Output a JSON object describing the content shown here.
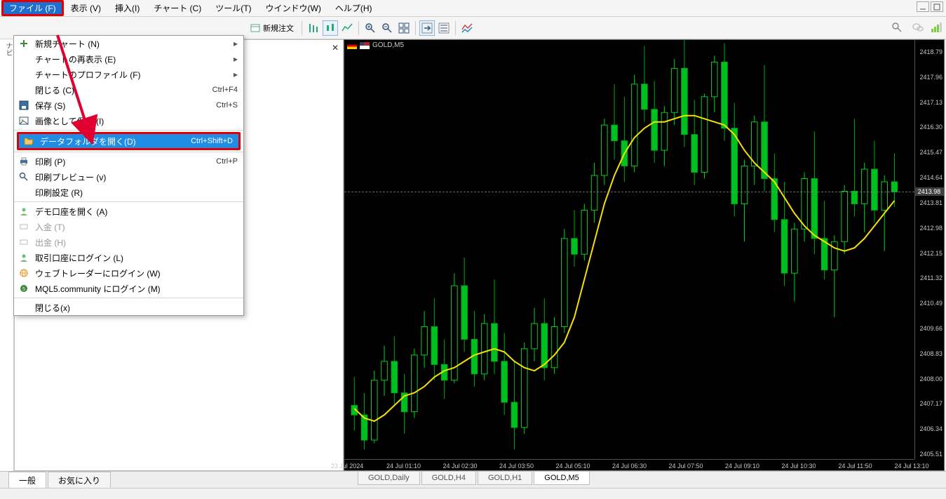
{
  "menubar": {
    "file": "ファイル (F)",
    "view": "表示 (V)",
    "insert": "挿入(I)",
    "chart": "チャート (C)",
    "tool": "ツール(T)",
    "window": "ウインドウ(W)",
    "help": "ヘルプ(H)"
  },
  "toolbar": {
    "new_order_label": "新規注文"
  },
  "file_menu": {
    "new_chart": "新規チャート (N)",
    "redisplay": "チャートの再表示 (E)",
    "profile": "チャートのプロファイル (F)",
    "close": "閉じる (C)",
    "close_sc": "Ctrl+F4",
    "save": "保存 (S)",
    "save_sc": "Ctrl+S",
    "save_image": "画像として保存 (I)",
    "open_data": "データフォルダを開く(D)",
    "open_data_sc": "Ctrl+Shift+D",
    "print": "印刷 (P)",
    "print_sc": "Ctrl+P",
    "preview": "印刷プレビュー (v)",
    "page_setup": "印刷設定 (R)",
    "open_demo": "デモ口座を開く (A)",
    "deposit": "入金 (T)",
    "withdraw": "出金 (H)",
    "login_trade": "取引口座にログイン (L)",
    "login_web": "ウェブトレーダーにログイン (W)",
    "login_mql5": "MQL5.community にログイン (M)",
    "exit": "閉じる(x)"
  },
  "nav_label": "ナビ",
  "chart": {
    "symbol": "GOLD,M5",
    "current_price": "2413.98",
    "y_ticks": [
      "2418.79",
      "2417.96",
      "2417.13",
      "2416.30",
      "2415.47",
      "2414.64",
      "2413.81",
      "2412.98",
      "2412.15",
      "2411.32",
      "2410.49",
      "2409.66",
      "2408.83",
      "2408.00",
      "2407.17",
      "2406.34",
      "2405.51"
    ],
    "x_ticks": [
      "23 Jul 2024",
      "24 Jul 01:10",
      "24 Jul 02:30",
      "24 Jul 03:50",
      "24 Jul 05:10",
      "24 Jul 06:30",
      "24 Jul 07:50",
      "24 Jul 09:10",
      "24 Jul 10:30",
      "24 Jul 11:50",
      "24 Jul 13:10"
    ]
  },
  "chart_tabs": {
    "daily": "GOLD,Daily",
    "h4": "GOLD,H4",
    "h1": "GOLD,H1",
    "m5": "GOLD,M5"
  },
  "left_tabs": {
    "general": "一般",
    "favorites": "お気に入り"
  },
  "chart_data": {
    "type": "candlestick",
    "symbol": "GOLD",
    "timeframe": "M5",
    "ylim": [
      2405.5,
      2418.8
    ],
    "current_price": 2413.98,
    "x_labels": [
      "23 Jul 2024",
      "24 Jul 01:10",
      "24 Jul 02:30",
      "24 Jul 03:50",
      "24 Jul 05:10",
      "24 Jul 06:30",
      "24 Jul 07:50",
      "24 Jul 09:10",
      "24 Jul 10:30",
      "24 Jul 11:50",
      "24 Jul 13:10"
    ],
    "ohlc": [
      {
        "o": 2407.2,
        "h": 2408.1,
        "l": 2406.4,
        "c": 2406.9
      },
      {
        "o": 2406.9,
        "h": 2407.6,
        "l": 2405.8,
        "c": 2406.1
      },
      {
        "o": 2406.1,
        "h": 2408.3,
        "l": 2406.0,
        "c": 2408.0
      },
      {
        "o": 2408.0,
        "h": 2409.1,
        "l": 2407.5,
        "c": 2408.6
      },
      {
        "o": 2408.6,
        "h": 2409.4,
        "l": 2407.2,
        "c": 2407.6
      },
      {
        "o": 2407.6,
        "h": 2408.2,
        "l": 2406.3,
        "c": 2407.0
      },
      {
        "o": 2407.0,
        "h": 2409.0,
        "l": 2406.8,
        "c": 2408.8
      },
      {
        "o": 2408.8,
        "h": 2410.2,
        "l": 2408.4,
        "c": 2409.7
      },
      {
        "o": 2409.7,
        "h": 2410.6,
        "l": 2408.0,
        "c": 2408.5
      },
      {
        "o": 2408.5,
        "h": 2409.3,
        "l": 2407.4,
        "c": 2408.0
      },
      {
        "o": 2408.0,
        "h": 2411.4,
        "l": 2407.9,
        "c": 2411.0
      },
      {
        "o": 2411.0,
        "h": 2411.9,
        "l": 2408.9,
        "c": 2409.3
      },
      {
        "o": 2409.3,
        "h": 2410.2,
        "l": 2407.8,
        "c": 2408.2
      },
      {
        "o": 2408.2,
        "h": 2410.1,
        "l": 2408.0,
        "c": 2409.8
      },
      {
        "o": 2409.8,
        "h": 2411.2,
        "l": 2408.2,
        "c": 2408.6
      },
      {
        "o": 2408.6,
        "h": 2409.5,
        "l": 2406.9,
        "c": 2407.3
      },
      {
        "o": 2407.3,
        "h": 2408.6,
        "l": 2405.8,
        "c": 2406.5
      },
      {
        "o": 2406.5,
        "h": 2409.2,
        "l": 2406.3,
        "c": 2409.0
      },
      {
        "o": 2409.0,
        "h": 2410.3,
        "l": 2408.6,
        "c": 2409.8
      },
      {
        "o": 2409.8,
        "h": 2410.6,
        "l": 2408.0,
        "c": 2408.4
      },
      {
        "o": 2408.4,
        "h": 2410.0,
        "l": 2408.2,
        "c": 2409.7
      },
      {
        "o": 2409.7,
        "h": 2412.8,
        "l": 2409.5,
        "c": 2412.5
      },
      {
        "o": 2412.5,
        "h": 2413.4,
        "l": 2411.6,
        "c": 2412.0
      },
      {
        "o": 2412.0,
        "h": 2413.6,
        "l": 2411.8,
        "c": 2413.4
      },
      {
        "o": 2413.4,
        "h": 2414.9,
        "l": 2413.0,
        "c": 2414.5
      },
      {
        "o": 2414.5,
        "h": 2416.3,
        "l": 2414.2,
        "c": 2416.1
      },
      {
        "o": 2416.1,
        "h": 2417.4,
        "l": 2415.0,
        "c": 2415.6
      },
      {
        "o": 2415.6,
        "h": 2417.0,
        "l": 2414.3,
        "c": 2414.8
      },
      {
        "o": 2414.8,
        "h": 2417.7,
        "l": 2414.6,
        "c": 2417.4
      },
      {
        "o": 2417.4,
        "h": 2418.6,
        "l": 2416.2,
        "c": 2416.6
      },
      {
        "o": 2416.6,
        "h": 2417.5,
        "l": 2414.9,
        "c": 2415.3
      },
      {
        "o": 2415.3,
        "h": 2416.7,
        "l": 2414.8,
        "c": 2416.5
      },
      {
        "o": 2416.5,
        "h": 2418.2,
        "l": 2416.1,
        "c": 2417.9
      },
      {
        "o": 2417.9,
        "h": 2418.8,
        "l": 2415.4,
        "c": 2415.8
      },
      {
        "o": 2415.8,
        "h": 2416.9,
        "l": 2414.2,
        "c": 2414.6
      },
      {
        "o": 2414.6,
        "h": 2417.1,
        "l": 2414.4,
        "c": 2417.0
      },
      {
        "o": 2417.0,
        "h": 2418.3,
        "l": 2416.5,
        "c": 2418.1
      },
      {
        "o": 2418.1,
        "h": 2418.7,
        "l": 2415.6,
        "c": 2416.0
      },
      {
        "o": 2416.0,
        "h": 2416.8,
        "l": 2413.2,
        "c": 2413.6
      },
      {
        "o": 2413.6,
        "h": 2415.0,
        "l": 2412.4,
        "c": 2414.8
      },
      {
        "o": 2414.8,
        "h": 2416.4,
        "l": 2414.2,
        "c": 2416.2
      },
      {
        "o": 2416.2,
        "h": 2418.0,
        "l": 2414.0,
        "c": 2414.4
      },
      {
        "o": 2414.4,
        "h": 2415.2,
        "l": 2412.7,
        "c": 2413.1
      },
      {
        "o": 2413.1,
        "h": 2414.3,
        "l": 2411.0,
        "c": 2411.4
      },
      {
        "o": 2411.4,
        "h": 2413.0,
        "l": 2410.5,
        "c": 2412.8
      },
      {
        "o": 2412.8,
        "h": 2414.6,
        "l": 2412.4,
        "c": 2414.4
      },
      {
        "o": 2414.4,
        "h": 2415.9,
        "l": 2412.0,
        "c": 2412.5
      },
      {
        "o": 2412.5,
        "h": 2413.7,
        "l": 2411.2,
        "c": 2411.5
      },
      {
        "o": 2411.5,
        "h": 2412.6,
        "l": 2410.0,
        "c": 2412.4
      },
      {
        "o": 2412.4,
        "h": 2414.2,
        "l": 2412.0,
        "c": 2414.0
      },
      {
        "o": 2414.0,
        "h": 2416.3,
        "l": 2413.2,
        "c": 2413.6
      },
      {
        "o": 2413.6,
        "h": 2414.9,
        "l": 2412.7,
        "c": 2414.7
      },
      {
        "o": 2414.7,
        "h": 2415.6,
        "l": 2413.0,
        "c": 2413.4
      },
      {
        "o": 2413.4,
        "h": 2414.5,
        "l": 2412.1,
        "c": 2414.3
      },
      {
        "o": 2414.3,
        "h": 2415.2,
        "l": 2413.5,
        "c": 2413.98
      }
    ],
    "ma": [
      2407.1,
      2406.8,
      2406.7,
      2406.9,
      2407.2,
      2407.5,
      2407.6,
      2407.8,
      2408.1,
      2408.3,
      2408.4,
      2408.6,
      2408.8,
      2408.9,
      2409.0,
      2408.9,
      2408.6,
      2408.4,
      2408.3,
      2408.5,
      2408.8,
      2409.2,
      2410.0,
      2411.2,
      2412.4,
      2413.6,
      2414.5,
      2415.2,
      2415.7,
      2416.0,
      2416.2,
      2416.2,
      2416.3,
      2416.4,
      2416.4,
      2416.3,
      2416.2,
      2416.1,
      2415.8,
      2415.3,
      2414.9,
      2414.6,
      2414.3,
      2413.8,
      2413.3,
      2412.9,
      2412.6,
      2412.4,
      2412.2,
      2412.1,
      2412.2,
      2412.5,
      2412.9,
      2413.3,
      2413.7
    ]
  }
}
